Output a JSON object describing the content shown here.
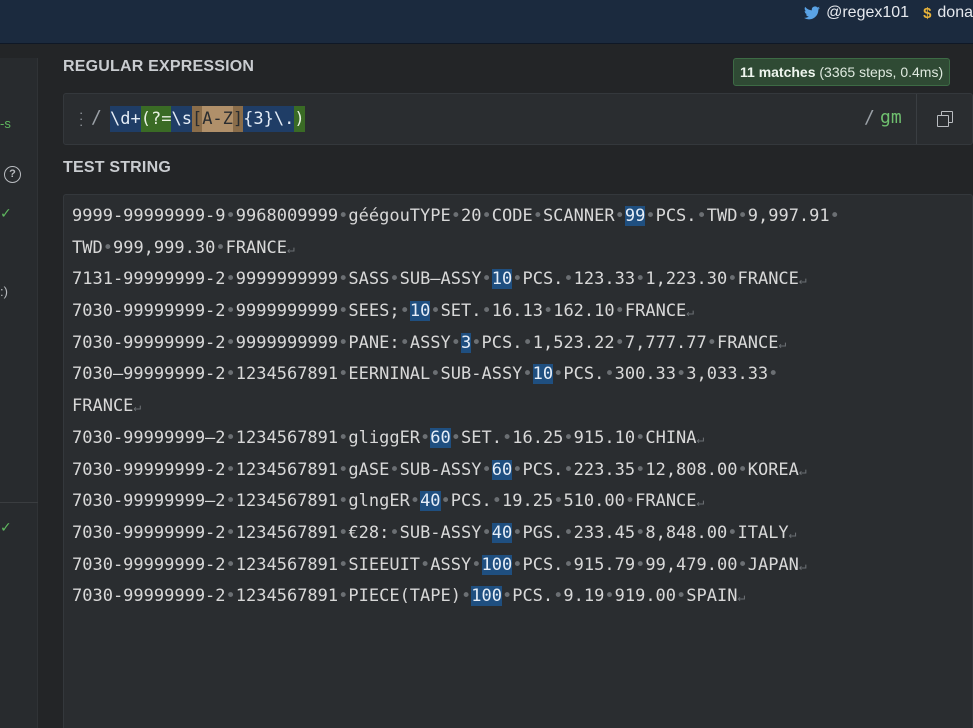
{
  "header": {
    "twitter_handle": "@regex101",
    "donate_label": "dona",
    "dollar_symbol": "$"
  },
  "sidebar": {
    "flavor_fragment": "-s",
    "help_symbol": "?",
    "check_symbol": "✓",
    "paren_fragment": ":)"
  },
  "regex": {
    "section_title": "REGULAR EXPRESSION",
    "delimiter_open": "/",
    "delimiter_close": "/",
    "flags": "gm",
    "tokens": [
      {
        "text": "\\d",
        "kind": "esc"
      },
      {
        "text": "+",
        "kind": "quant"
      },
      {
        "text": "(?=",
        "kind": "look"
      },
      {
        "text": "\\s",
        "kind": "esc"
      },
      {
        "text": "[",
        "kind": "class"
      },
      {
        "text": "A-Z",
        "kind": "classinner"
      },
      {
        "text": "]",
        "kind": "class"
      },
      {
        "text": "{3}",
        "kind": "quant"
      },
      {
        "text": "\\.",
        "kind": "esc"
      },
      {
        "text": ")",
        "kind": "look"
      }
    ]
  },
  "match_info": {
    "count_label": "11 matches",
    "detail": " (3365 steps, 0.4ms)"
  },
  "test_string": {
    "section_title": "TEST STRING",
    "lines": [
      {
        "segs": [
          "9999-99999999-9",
          "9968009999",
          "géégouTYPE",
          "20",
          "CODE",
          "SCANNER",
          "[99]",
          "PCS.",
          "TWD",
          "9,997.91",
          ""
        ],
        "nl": false
      },
      {
        "segs": [
          "TWD",
          "999,999.30",
          "FRANCE"
        ],
        "nl": true
      },
      {
        "segs": [
          "7131-99999999-2",
          "9999999999",
          "SASS",
          "SUB—ASSY",
          "[10]",
          "PCS.",
          "123.33",
          "1,223.30",
          "FRANCE"
        ],
        "nl": true
      },
      {
        "segs": [
          "7030-99999999-2",
          "9999999999",
          "SEES;",
          "[10]",
          "SET.",
          "16.13",
          "162.10",
          "FRANCE"
        ],
        "nl": true
      },
      {
        "segs": [
          "7030-99999999-2",
          "9999999999",
          "PANE:",
          "ASSY",
          "[3]",
          "PCS.",
          "1,523.22",
          "7,777.77",
          "FRANCE"
        ],
        "nl": true
      },
      {
        "segs": [
          "7030—99999999-2",
          "1234567891",
          "EERNINAL",
          "SUB-ASSY",
          "[10]",
          "PCS.",
          "300.33",
          "3,033.33",
          ""
        ],
        "nl": false
      },
      {
        "segs": [
          "FRANCE"
        ],
        "nl": true
      },
      {
        "segs": [
          "7030-99999999—2",
          "1234567891",
          "gliggER",
          "[60]",
          "SET.",
          "16.25",
          "915.10",
          "CHINA"
        ],
        "nl": true
      },
      {
        "segs": [
          "7030-99999999-2",
          "1234567891",
          "gASE",
          "SUB-ASSY",
          "[60]",
          "PCS.",
          "223.35",
          "12,808.00",
          "KOREA"
        ],
        "nl": true
      },
      {
        "segs": [
          "7030-99999999—2",
          "1234567891",
          "glngER",
          "[40]",
          "PCS.",
          "19.25",
          "510.00",
          "FRANCE"
        ],
        "nl": true
      },
      {
        "segs": [
          "7030-99999999-2",
          "1234567891",
          "€28:",
          "SUB-ASSY",
          "[40]",
          "PGS.",
          "233.45",
          "8,848.00",
          "ITALY"
        ],
        "nl": true
      },
      {
        "segs": [
          "7030-99999999-2",
          "1234567891",
          "SIEEUIT",
          "ASSY",
          "[100]",
          "PCS.",
          "915.79",
          "99,479.00",
          "JAPAN"
        ],
        "nl": true
      },
      {
        "segs": [
          "7030-99999999-2",
          "1234567891",
          "PIECE(TAPE)",
          "[100]",
          "PCS.",
          "9.19",
          "919.00",
          "SPAIN"
        ],
        "nl": true
      }
    ]
  },
  "colors": {
    "match_highlight": "#1f4f80",
    "header_bg": "#1b2a3e",
    "panel_bg": "#2a2d30",
    "page_bg": "#232527"
  }
}
